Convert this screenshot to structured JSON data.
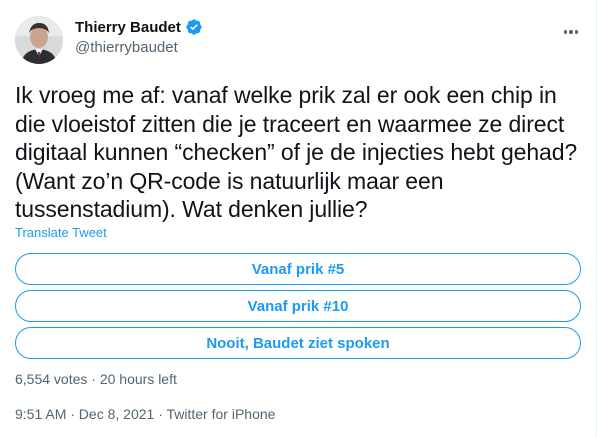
{
  "author": {
    "display_name": "Thierry Baudet",
    "handle": "@thierrybaudet",
    "verified": true
  },
  "tweet": {
    "text": "Ik vroeg me af: vanaf welke prik zal er ook een chip in die vloeistof zitten die je traceert en waarmee ze direct digitaal kunnen “checken” of je de injecties hebt gehad? (Want zo’n QR-code is natuurlijk maar een tussenstadium). Wat denken jullie?",
    "translate_label": "Translate Tweet"
  },
  "poll": {
    "options": [
      {
        "label": "Vanaf prik #5"
      },
      {
        "label": "Vanaf prik #10"
      },
      {
        "label": "Nooit, Baudet ziet spoken"
      }
    ],
    "meta": "6,554 votes · 20 hours left"
  },
  "meta": {
    "timestamp": "9:51 AM · Dec 8, 2021 · Twitter for iPhone"
  },
  "colors": {
    "accent": "#1d9bf0",
    "secondary_text": "#536471",
    "primary_text": "#0f1419"
  },
  "icons": {
    "verified": "verified-badge-icon",
    "more": "more-options-icon"
  }
}
